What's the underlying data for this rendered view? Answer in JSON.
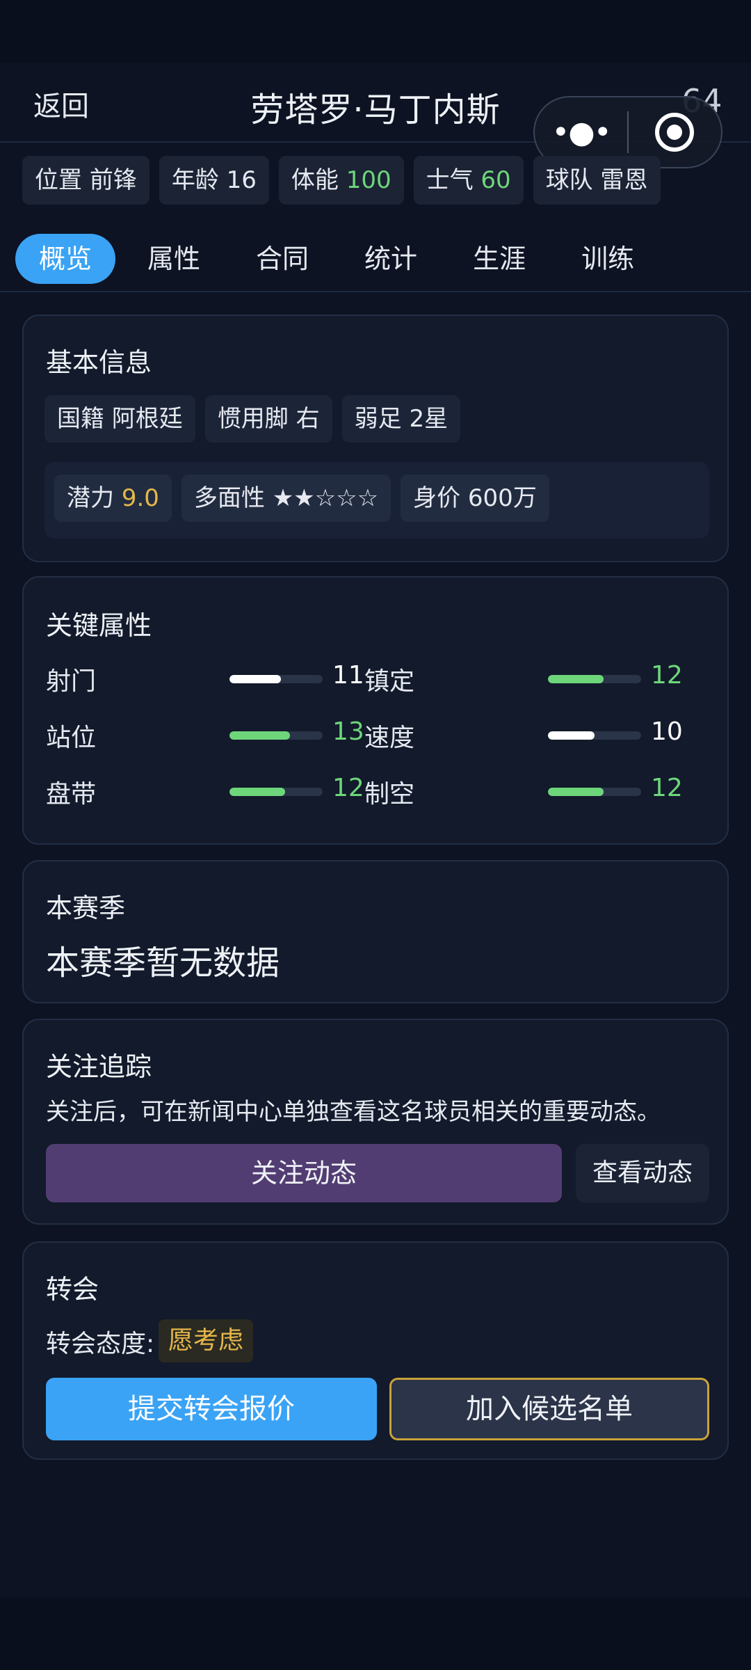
{
  "header": {
    "back_label": "返回",
    "title": "劳塔罗·马丁内斯",
    "rating": "64"
  },
  "capsule": {
    "more_icon": "more-dots-icon",
    "close_icon": "target-close-icon"
  },
  "summary_chips": [
    {
      "label": "位置",
      "value": "前锋"
    },
    {
      "label": "年龄",
      "value": "16"
    },
    {
      "label": "体能",
      "value": "100"
    },
    {
      "label": "士气",
      "value": "60"
    },
    {
      "label": "球队",
      "value": "雷恩"
    }
  ],
  "tabs": [
    {
      "label": "概览",
      "active": true
    },
    {
      "label": "属性",
      "active": false
    },
    {
      "label": "合同",
      "active": false
    },
    {
      "label": "统计",
      "active": false
    },
    {
      "label": "生涯",
      "active": false
    },
    {
      "label": "训练",
      "active": false
    }
  ],
  "basic_info": {
    "title": "基本信息",
    "row1": [
      {
        "label": "国籍",
        "value": "阿根廷"
      },
      {
        "label": "惯用脚",
        "value": "右"
      },
      {
        "label": "弱足",
        "value": "2星"
      }
    ],
    "row2": [
      {
        "label": "潜力",
        "value": "9.0"
      },
      {
        "label": "多面性",
        "value": "★★☆☆☆"
      },
      {
        "label": "身价",
        "value": "600万"
      }
    ]
  },
  "key_attributes": {
    "title": "关键属性",
    "max": 20,
    "colors": {
      "high": "#6ed67a",
      "normal": "#ffffff"
    },
    "items": [
      {
        "name": "射门",
        "value": 11
      },
      {
        "name": "镇定",
        "value": 12
      },
      {
        "name": "站位",
        "value": 13
      },
      {
        "name": "速度",
        "value": 10
      },
      {
        "name": "盘带",
        "value": 12
      },
      {
        "name": "制空",
        "value": 12
      }
    ]
  },
  "season": {
    "title": "本赛季",
    "empty_text": "本赛季暂无数据"
  },
  "follow": {
    "title": "关注追踪",
    "description": "关注后，可在新闻中心单独查看这名球员相关的重要动态。",
    "follow_button": "关注动态",
    "view_button": "查看动态"
  },
  "transfer": {
    "title": "转会",
    "attitude_label": "转会态度:",
    "attitude_value": "愿考虑",
    "offer_button": "提交转会报价",
    "shortlist_button": "加入候选名单"
  }
}
